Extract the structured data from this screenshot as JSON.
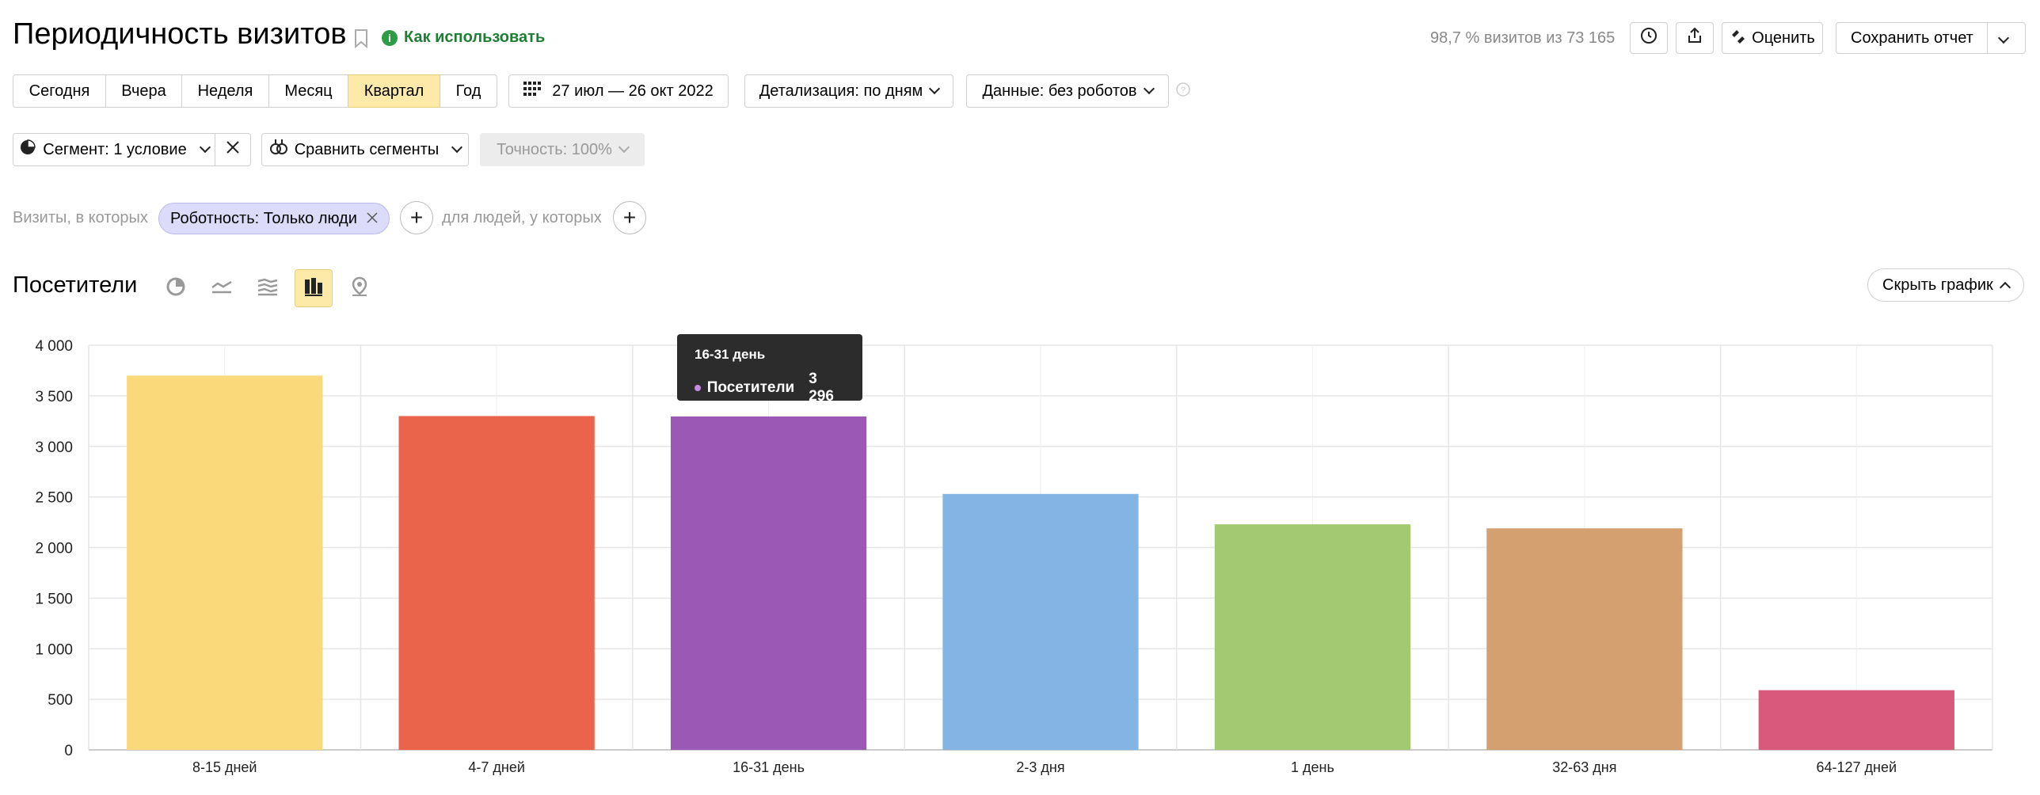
{
  "header": {
    "title": "Периодичность визитов",
    "howto_label": "Как использовать",
    "visits_info": "98,7 % визитов из 73 165",
    "rate_label": "Оценить",
    "save_label": "Сохранить отчет"
  },
  "periods": {
    "items": [
      "Сегодня",
      "Вчера",
      "Неделя",
      "Месяц",
      "Квартал",
      "Год"
    ],
    "active": "Квартал"
  },
  "date_range": "27 июл — 26 окт 2022",
  "detail_label": "Детализация: по дням",
  "data_label": "Данные: без роботов",
  "segment_label": "Сегмент: 1 условие",
  "compare_label": "Сравнить сегменты",
  "accuracy_label": "Точность: 100%",
  "filters": {
    "visits_label": "Визиты, в которых",
    "chip_label": "Роботность: Только люди",
    "people_label": "для людей, у которых"
  },
  "section": {
    "title": "Посетители",
    "hide_chart_label": "Скрыть график"
  },
  "tooltip": {
    "category": "16-31 день",
    "series": "Посетители",
    "value": "3 296"
  },
  "chart_data": {
    "type": "bar",
    "categories": [
      "8-15 дней",
      "4-7 дней",
      "16-31 день",
      "2-3 дня",
      "1 день",
      "32-63 дня",
      "64-127 дней"
    ],
    "values": [
      3700,
      3300,
      3296,
      2530,
      2230,
      2190,
      590
    ],
    "colors": [
      "#f9d97a",
      "#ea644b",
      "#9b59b5",
      "#84b4e3",
      "#a3ca72",
      "#d4a070",
      "#d9597b"
    ],
    "ylim": [
      0,
      4000
    ],
    "yticks": [
      "0",
      "500",
      "1 000",
      "1 500",
      "2 000",
      "2 500",
      "3 000",
      "3 500",
      "4 000"
    ],
    "grid": true
  }
}
